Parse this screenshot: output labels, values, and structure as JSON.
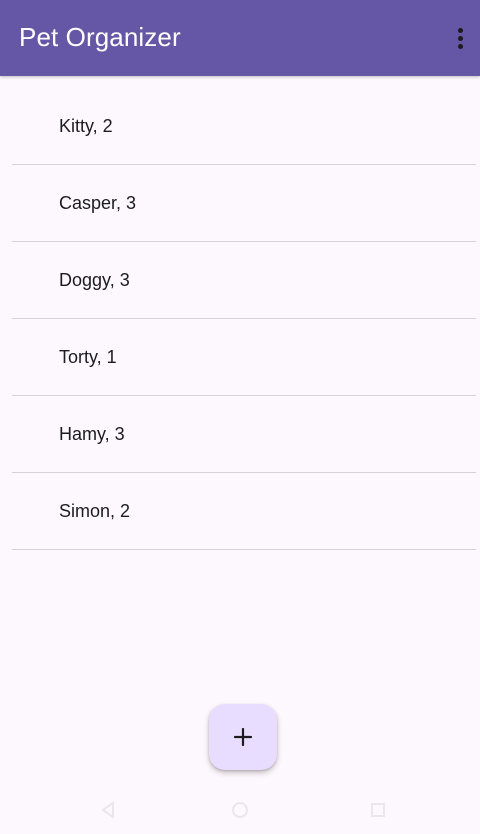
{
  "app_bar": {
    "title": "Pet Organizer",
    "menu_icon": "more-vert-icon",
    "background_color": "#6656a6"
  },
  "pets": [
    {
      "label": "Kitty, 2"
    },
    {
      "label": "Casper, 3"
    },
    {
      "label": "Doggy, 3"
    },
    {
      "label": "Torty, 1"
    },
    {
      "label": "Hamy, 3"
    },
    {
      "label": "Simon, 2"
    }
  ],
  "fab": {
    "icon": "add-icon",
    "background_color": "#e9ddff"
  },
  "colors": {
    "background": "#fdf8fd",
    "text": "#1c1b1f",
    "divider": "#d6d3d8"
  }
}
